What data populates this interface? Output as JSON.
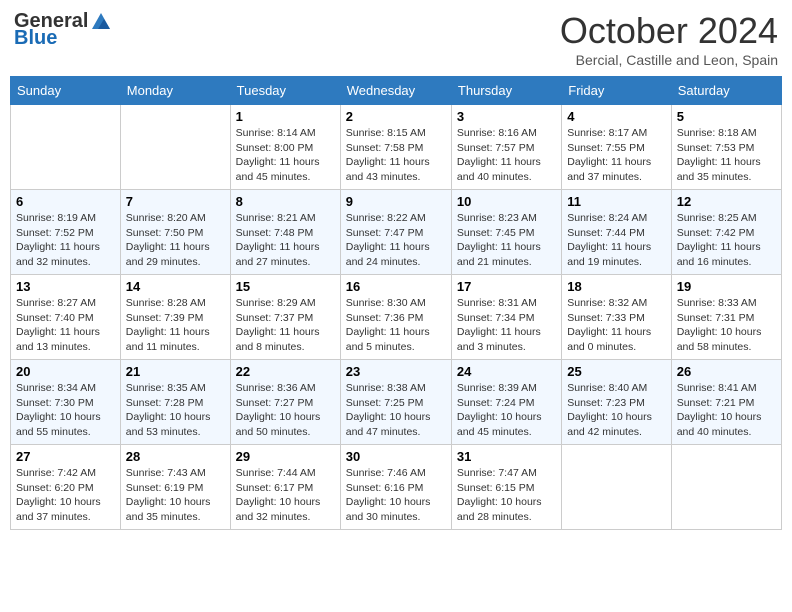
{
  "logo": {
    "general": "General",
    "blue": "Blue"
  },
  "title": "October 2024",
  "location": "Bercial, Castille and Leon, Spain",
  "days_of_week": [
    "Sunday",
    "Monday",
    "Tuesday",
    "Wednesday",
    "Thursday",
    "Friday",
    "Saturday"
  ],
  "weeks": [
    [
      {
        "day": "",
        "info": ""
      },
      {
        "day": "",
        "info": ""
      },
      {
        "day": "1",
        "info": "Sunrise: 8:14 AM\nSunset: 8:00 PM\nDaylight: 11 hours and 45 minutes."
      },
      {
        "day": "2",
        "info": "Sunrise: 8:15 AM\nSunset: 7:58 PM\nDaylight: 11 hours and 43 minutes."
      },
      {
        "day": "3",
        "info": "Sunrise: 8:16 AM\nSunset: 7:57 PM\nDaylight: 11 hours and 40 minutes."
      },
      {
        "day": "4",
        "info": "Sunrise: 8:17 AM\nSunset: 7:55 PM\nDaylight: 11 hours and 37 minutes."
      },
      {
        "day": "5",
        "info": "Sunrise: 8:18 AM\nSunset: 7:53 PM\nDaylight: 11 hours and 35 minutes."
      }
    ],
    [
      {
        "day": "6",
        "info": "Sunrise: 8:19 AM\nSunset: 7:52 PM\nDaylight: 11 hours and 32 minutes."
      },
      {
        "day": "7",
        "info": "Sunrise: 8:20 AM\nSunset: 7:50 PM\nDaylight: 11 hours and 29 minutes."
      },
      {
        "day": "8",
        "info": "Sunrise: 8:21 AM\nSunset: 7:48 PM\nDaylight: 11 hours and 27 minutes."
      },
      {
        "day": "9",
        "info": "Sunrise: 8:22 AM\nSunset: 7:47 PM\nDaylight: 11 hours and 24 minutes."
      },
      {
        "day": "10",
        "info": "Sunrise: 8:23 AM\nSunset: 7:45 PM\nDaylight: 11 hours and 21 minutes."
      },
      {
        "day": "11",
        "info": "Sunrise: 8:24 AM\nSunset: 7:44 PM\nDaylight: 11 hours and 19 minutes."
      },
      {
        "day": "12",
        "info": "Sunrise: 8:25 AM\nSunset: 7:42 PM\nDaylight: 11 hours and 16 minutes."
      }
    ],
    [
      {
        "day": "13",
        "info": "Sunrise: 8:27 AM\nSunset: 7:40 PM\nDaylight: 11 hours and 13 minutes."
      },
      {
        "day": "14",
        "info": "Sunrise: 8:28 AM\nSunset: 7:39 PM\nDaylight: 11 hours and 11 minutes."
      },
      {
        "day": "15",
        "info": "Sunrise: 8:29 AM\nSunset: 7:37 PM\nDaylight: 11 hours and 8 minutes."
      },
      {
        "day": "16",
        "info": "Sunrise: 8:30 AM\nSunset: 7:36 PM\nDaylight: 11 hours and 5 minutes."
      },
      {
        "day": "17",
        "info": "Sunrise: 8:31 AM\nSunset: 7:34 PM\nDaylight: 11 hours and 3 minutes."
      },
      {
        "day": "18",
        "info": "Sunrise: 8:32 AM\nSunset: 7:33 PM\nDaylight: 11 hours and 0 minutes."
      },
      {
        "day": "19",
        "info": "Sunrise: 8:33 AM\nSunset: 7:31 PM\nDaylight: 10 hours and 58 minutes."
      }
    ],
    [
      {
        "day": "20",
        "info": "Sunrise: 8:34 AM\nSunset: 7:30 PM\nDaylight: 10 hours and 55 minutes."
      },
      {
        "day": "21",
        "info": "Sunrise: 8:35 AM\nSunset: 7:28 PM\nDaylight: 10 hours and 53 minutes."
      },
      {
        "day": "22",
        "info": "Sunrise: 8:36 AM\nSunset: 7:27 PM\nDaylight: 10 hours and 50 minutes."
      },
      {
        "day": "23",
        "info": "Sunrise: 8:38 AM\nSunset: 7:25 PM\nDaylight: 10 hours and 47 minutes."
      },
      {
        "day": "24",
        "info": "Sunrise: 8:39 AM\nSunset: 7:24 PM\nDaylight: 10 hours and 45 minutes."
      },
      {
        "day": "25",
        "info": "Sunrise: 8:40 AM\nSunset: 7:23 PM\nDaylight: 10 hours and 42 minutes."
      },
      {
        "day": "26",
        "info": "Sunrise: 8:41 AM\nSunset: 7:21 PM\nDaylight: 10 hours and 40 minutes."
      }
    ],
    [
      {
        "day": "27",
        "info": "Sunrise: 7:42 AM\nSunset: 6:20 PM\nDaylight: 10 hours and 37 minutes."
      },
      {
        "day": "28",
        "info": "Sunrise: 7:43 AM\nSunset: 6:19 PM\nDaylight: 10 hours and 35 minutes."
      },
      {
        "day": "29",
        "info": "Sunrise: 7:44 AM\nSunset: 6:17 PM\nDaylight: 10 hours and 32 minutes."
      },
      {
        "day": "30",
        "info": "Sunrise: 7:46 AM\nSunset: 6:16 PM\nDaylight: 10 hours and 30 minutes."
      },
      {
        "day": "31",
        "info": "Sunrise: 7:47 AM\nSunset: 6:15 PM\nDaylight: 10 hours and 28 minutes."
      },
      {
        "day": "",
        "info": ""
      },
      {
        "day": "",
        "info": ""
      }
    ]
  ]
}
